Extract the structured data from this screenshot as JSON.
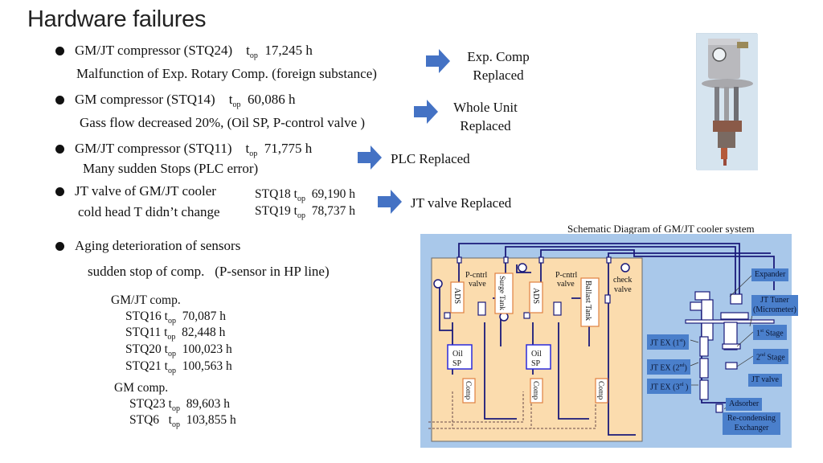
{
  "title": "Hardware failures",
  "items": [
    {
      "headline": "GM/JT compressor (STQ24)",
      "top_label": "t",
      "top_sub": "op",
      "hours": "17,245 h",
      "detail": "Malfunction of Exp. Rotary Comp. (foreign substance)",
      "result": [
        "Exp. Comp",
        "Replaced"
      ]
    },
    {
      "headline": "GM compressor (STQ14)",
      "top_label": "t",
      "top_sub": "op",
      "hours": "60,086 h",
      "detail": "Gass flow decreased 20%,  (Oil SP,  P-control valve )",
      "result": [
        "Whole Unit",
        "Replaced"
      ]
    },
    {
      "headline": "GM/JT compressor (STQ11)",
      "top_label": "t",
      "top_sub": "op",
      "hours": "71,775 h",
      "detail": "Many sudden Stops (PLC error)",
      "result": [
        "PLC Replaced"
      ]
    },
    {
      "headline": "JT valve of GM/JT cooler",
      "detail": "cold head T didn’t change",
      "units": [
        {
          "name": "STQ18",
          "top_label": "t",
          "top_sub": "op",
          "hours": "69,190 h"
        },
        {
          "name": "STQ19",
          "top_label": "t",
          "top_sub": "op",
          "hours": "78,737 h"
        }
      ],
      "result": [
        "JT valve Replaced"
      ]
    }
  ],
  "aging": {
    "headline": "Aging deterioration of sensors",
    "detail": "sudden stop of comp.",
    "detail_note": "(P-sensor in HP line)",
    "groups": [
      {
        "name": "GM/JT comp.",
        "units": [
          {
            "name": "STQ16",
            "top_label": "t",
            "top_sub": "op",
            "hours": "70,087 h"
          },
          {
            "name": "STQ11",
            "top_label": "t",
            "top_sub": "op",
            "hours": "82,448 h"
          },
          {
            "name": "STQ20",
            "top_label": "t",
            "top_sub": "op",
            "hours": "100,023 h"
          },
          {
            "name": "STQ21",
            "top_label": "t",
            "top_sub": "op",
            "hours": "100,563 h"
          }
        ]
      },
      {
        "name": "GM comp.",
        "units": [
          {
            "name": "STQ23",
            "top_label": "t",
            "top_sub": "op",
            "hours": "89,603 h"
          },
          {
            "name": "STQ6",
            "top_label": "t",
            "top_sub": "op",
            "hours": "103,855 h"
          }
        ]
      }
    ]
  },
  "diagram": {
    "caption": "Schematic Diagram of GM/JT cooler system",
    "compressor_labels": {
      "p_cntrl_1": [
        "P-cntrl",
        "valve"
      ],
      "surge_tank": "Surge Tank",
      "ads_1": "ADS",
      "ads_2": "ADS",
      "p_cntrl_2": [
        "P-cntrl",
        "valve"
      ],
      "ballast_tank": "Ballast Tank",
      "check_valve": [
        "check",
        "valve"
      ],
      "oil_sp_1": [
        "Oil",
        "SP"
      ],
      "oil_sp_2": [
        "Oil",
        "SP"
      ],
      "comp_1": "Comp",
      "comp_2": "Comp",
      "comp_3": "Comp"
    },
    "cold_head_labels": {
      "expander": "Expander",
      "jt_tuner": [
        "JT Tuner",
        "(Micrometer)"
      ],
      "stage_1": "1st Stage",
      "stage_2": "2nd Stage",
      "jt_valve": "JT valve",
      "jt_ex_1": "JT EX (1st)",
      "jt_ex_2": "JT EX (2nd)",
      "jt_ex_3": "JT EX (3rd )",
      "adsorber": "Adsorber",
      "recondensing": [
        "Re-condensing",
        "Exchanger"
      ]
    }
  },
  "colors": {
    "arrow": "#4472c4",
    "diagram_bg": "#a9c8ea",
    "compressor_panel": "#fbdcae",
    "label_box": "#4a7fcb",
    "pipe": "#1a1a7a"
  }
}
